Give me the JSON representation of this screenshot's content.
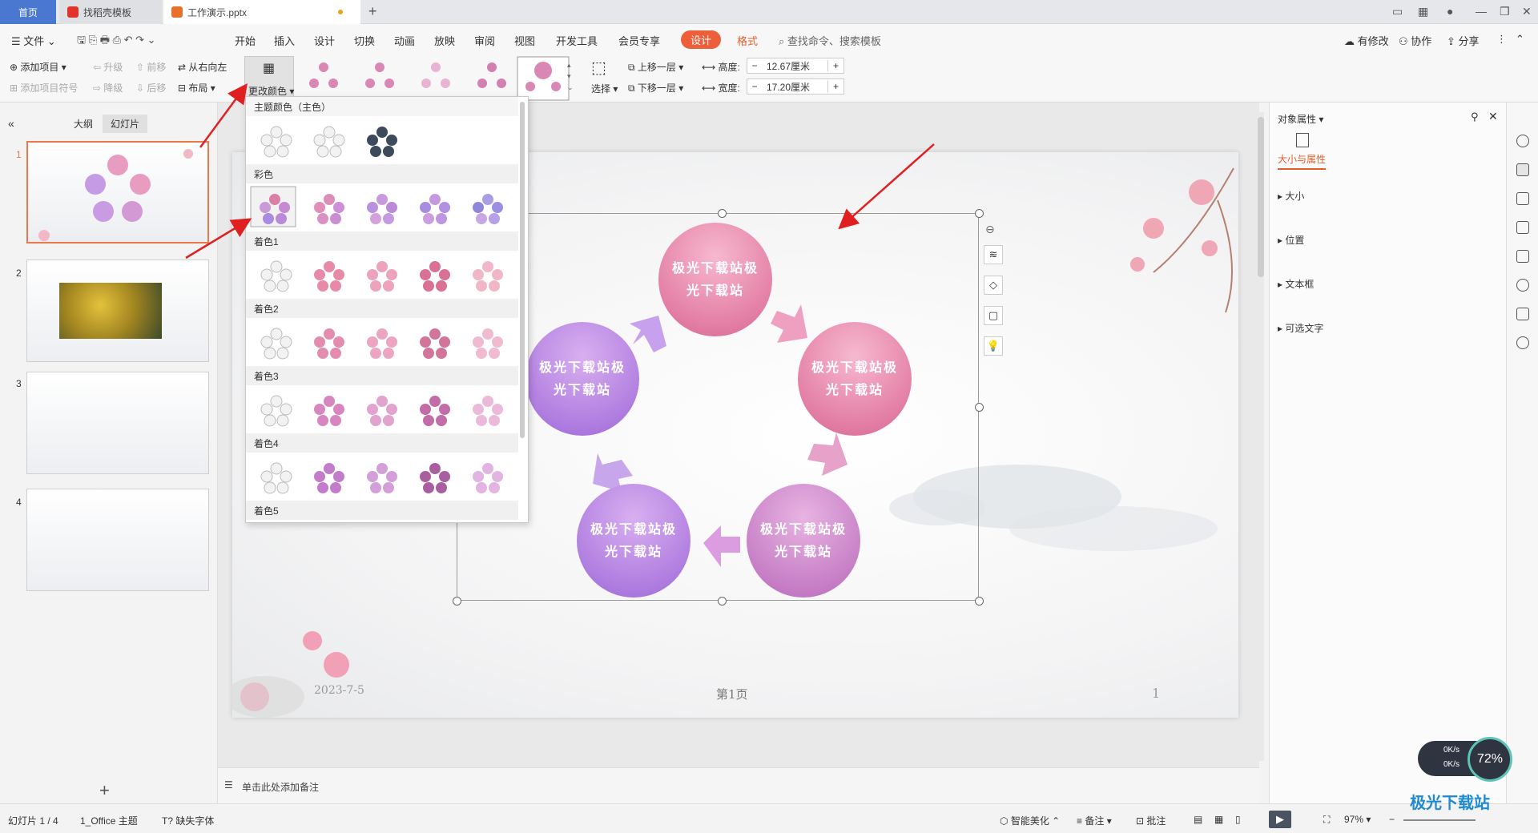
{
  "tabs": {
    "home": "首页",
    "templates": "找稻壳模板",
    "doc": "工作演示.pptx"
  },
  "menu": {
    "file": "文件",
    "items": [
      "开始",
      "插入",
      "设计",
      "切换",
      "动画",
      "放映",
      "审阅",
      "视图",
      "开发工具",
      "会员专享"
    ],
    "design": "设计",
    "format": "格式",
    "search": "查找命令、搜索模板",
    "changes": "有修改",
    "collab": "协作",
    "share": "分享"
  },
  "ribbon": {
    "add_item": "添加项目",
    "add_bullet": "添加项目符号",
    "promote": "升级",
    "demote": "降级",
    "move_forward": "前移",
    "move_back": "后移",
    "rtl": "从右向左",
    "layout": "布局",
    "change_color": "更改颜色",
    "select": "选择",
    "bring_forward": "上移一层",
    "send_backward": "下移一层",
    "height_label": "高度:",
    "height_value": "12.67厘米",
    "width_label": "宽度:",
    "width_value": "17.20厘米"
  },
  "dropdown": {
    "sections": [
      "主题颜色（主色）",
      "彩色",
      "着色1",
      "着色2",
      "着色3",
      "着色4",
      "着色5"
    ]
  },
  "left": {
    "outline": "大纲",
    "slides": "幻灯片",
    "slide_numbers": [
      "1",
      "2",
      "3",
      "4"
    ]
  },
  "slide": {
    "circle_text": "极光下载站极光下载站",
    "date": "2023-7-5",
    "page": "第1页",
    "num": "1"
  },
  "notes": {
    "placeholder": "单击此处添加备注"
  },
  "right": {
    "title": "对象属性",
    "tab": "大小与属性",
    "sections": [
      "大小",
      "位置",
      "文本框",
      "可选文字"
    ]
  },
  "status": {
    "slide": "幻灯片 1 / 4",
    "theme": "1_Office 主题",
    "missing_font": "缺失字体",
    "beautify": "智能美化",
    "notes": "备注",
    "comment": "批注",
    "zoom": "97%"
  },
  "net": {
    "up": "0K/s",
    "down": "0K/s",
    "cpu": "72%"
  },
  "watermark": "极光下载站"
}
